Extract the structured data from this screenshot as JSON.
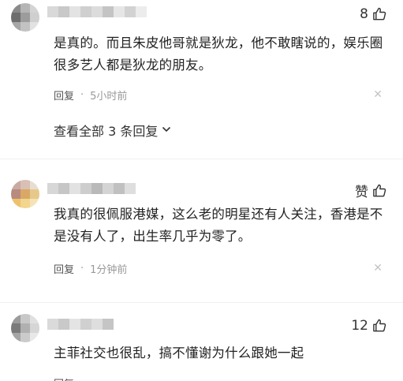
{
  "comments": [
    {
      "likes": "8",
      "text": "是真的。而且朱皮他哥就是狄龙，他不敢瞎说的，娱乐圈很多艺人都是狄龙的朋友。",
      "reply_label": "回复",
      "separator": "·",
      "time": "5小时前",
      "view_all": "查看全部 3 条回复"
    },
    {
      "likes": "赞",
      "text": "我真的很佩服港媒，这么老的明星还有人关注，香港是不是没有人了，出生率几乎为零了。",
      "reply_label": "回复",
      "separator": "·",
      "time": "1分钟前"
    },
    {
      "likes": "12",
      "text": "主菲社交也很乱，搞不懂谢为什么跟她一起",
      "reply_label": "回复",
      "separator": "·",
      "time": ""
    }
  ],
  "icons": {
    "like": "thumbs-up-icon",
    "close": "close-icon",
    "chevron": "chevron-down-icon"
  },
  "colors": {
    "text": "#222222",
    "meta": "#999999",
    "close": "#c4c4c4"
  }
}
